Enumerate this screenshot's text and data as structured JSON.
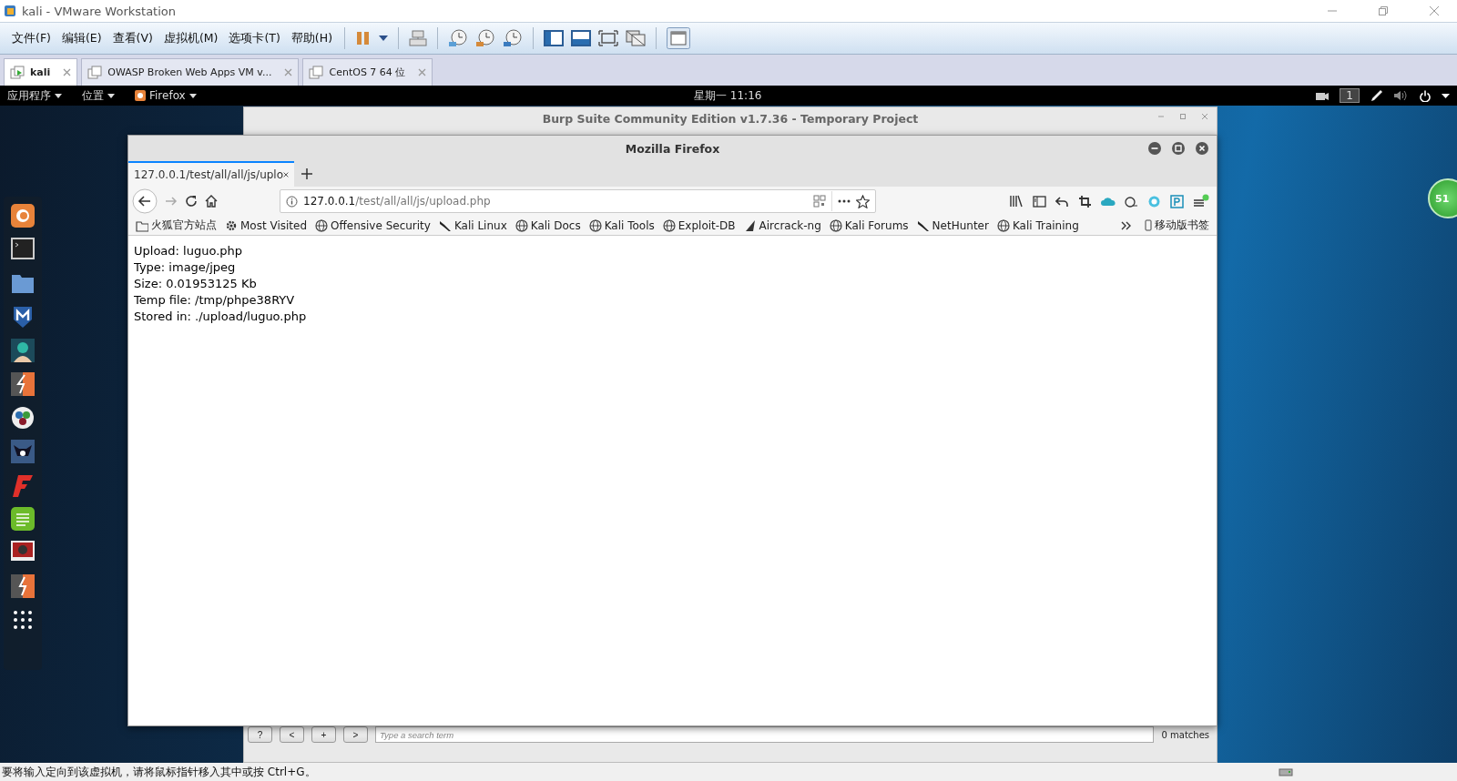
{
  "window": {
    "title": "kali - VMware Workstation"
  },
  "menu": [
    "文件(F)",
    "编辑(E)",
    "查看(V)",
    "虚拟机(M)",
    "选项卡(T)",
    "帮助(H)"
  ],
  "vm_tabs": [
    {
      "label": "kali",
      "selected": true
    },
    {
      "label": "OWASP Broken Web Apps VM v...",
      "selected": false
    },
    {
      "label": "CentOS 7 64 位",
      "selected": false
    }
  ],
  "guest_top_bar": {
    "menus": [
      "应用程序",
      "位置",
      "Firefox"
    ],
    "clock": "星期一 11:16",
    "workspace": "1"
  },
  "burp": {
    "title": "Burp Suite Community Edition v1.7.36 - Temporary Project",
    "search_buttons": [
      "?",
      "<",
      "+",
      ">"
    ],
    "search": {
      "placeholder": "Type a search term"
    },
    "matches": "0 matches"
  },
  "firefox": {
    "title": "Mozilla Firefox",
    "tabs": [
      {
        "label": "127.0.0.1/test/all/all/js/uplo",
        "selected": true
      }
    ],
    "url": {
      "host": "127.0.0.1",
      "path": "/test/all/all/js/upload.php"
    },
    "bookmarks": [
      {
        "label": "火狐官方站点",
        "kind": "folder"
      },
      {
        "label": "Most Visited",
        "kind": "gear"
      },
      {
        "label": "Offensive Security",
        "kind": "globe"
      },
      {
        "label": "Kali Linux",
        "kind": "dragon"
      },
      {
        "label": "Kali Docs",
        "kind": "globe"
      },
      {
        "label": "Kali Tools",
        "kind": "globe"
      },
      {
        "label": "Exploit-DB",
        "kind": "globe"
      },
      {
        "label": "Aircrack-ng",
        "kind": "wing"
      },
      {
        "label": "Kali Forums",
        "kind": "globe"
      },
      {
        "label": "NetHunter",
        "kind": "dragon"
      },
      {
        "label": "Kali Training",
        "kind": "globe"
      }
    ],
    "mobile_bookmarks": "移动版书签",
    "content": [
      "Upload: luguo.php",
      "Type: image/jpeg",
      "Size: 0.01953125 Kb",
      "Temp file: /tmp/phpe38RYV",
      "Stored in: ./upload/luguo.php"
    ]
  },
  "floating_badge": "51",
  "status_bar": "要将输入定向到该虚拟机，请将鼠标指针移入其中或按 Ctrl+G。"
}
